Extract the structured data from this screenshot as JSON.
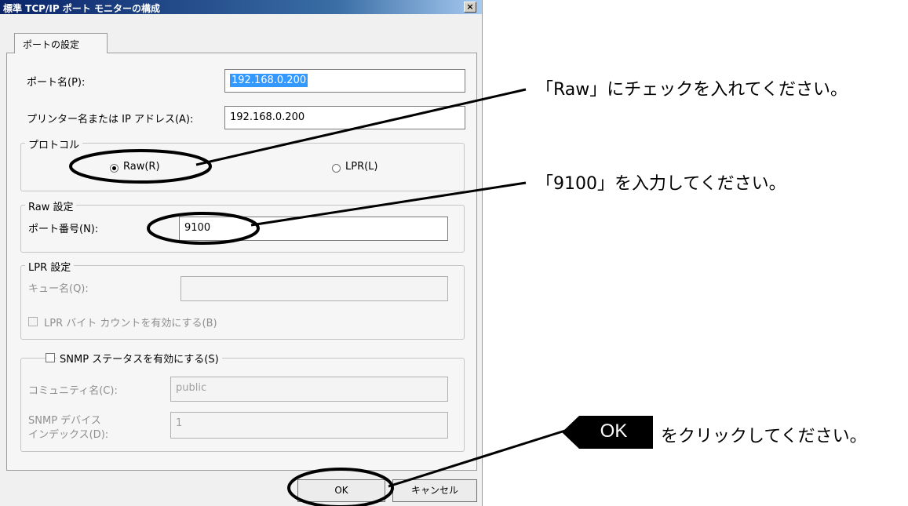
{
  "dialog": {
    "title": "標準 TCP/IP ポート モニターの構成",
    "close_label": "×",
    "tab_label": "ポートの設定",
    "port_name": {
      "label": "ポート名(P):",
      "value": "192.168.0.200"
    },
    "printer_address": {
      "label": "プリンター名または IP アドレス(A):",
      "value": "192.168.0.200"
    },
    "protocol": {
      "title": "プロトコル",
      "raw_label": "Raw(R)",
      "lpr_label": "LPR(L)",
      "selected": "Raw"
    },
    "raw_settings": {
      "title": "Raw 設定",
      "port_number_label": "ポート番号(N):",
      "port_number_value": "9100"
    },
    "lpr_settings": {
      "title": "LPR 設定",
      "queue_label": "キュー名(Q):",
      "queue_value": "",
      "byte_count_label": "LPR バイト カウントを有効にする(B)"
    },
    "snmp": {
      "title": "SNMP ステータスを有効にする(S)",
      "community_label": "コミュニティ名(C):",
      "community_value": "public",
      "device_index_label_1": "SNMP デバイス",
      "device_index_label_2": "インデックス(D):",
      "device_index_value": "1"
    },
    "ok_label": "OK",
    "cancel_label": "キャンセル"
  },
  "annotations": {
    "raw_note": "「Raw」にチェックを入れてください。",
    "port_note": "「9100」を入力してください。",
    "ok_badge": "OK",
    "ok_note": "をクリックしてください。"
  }
}
